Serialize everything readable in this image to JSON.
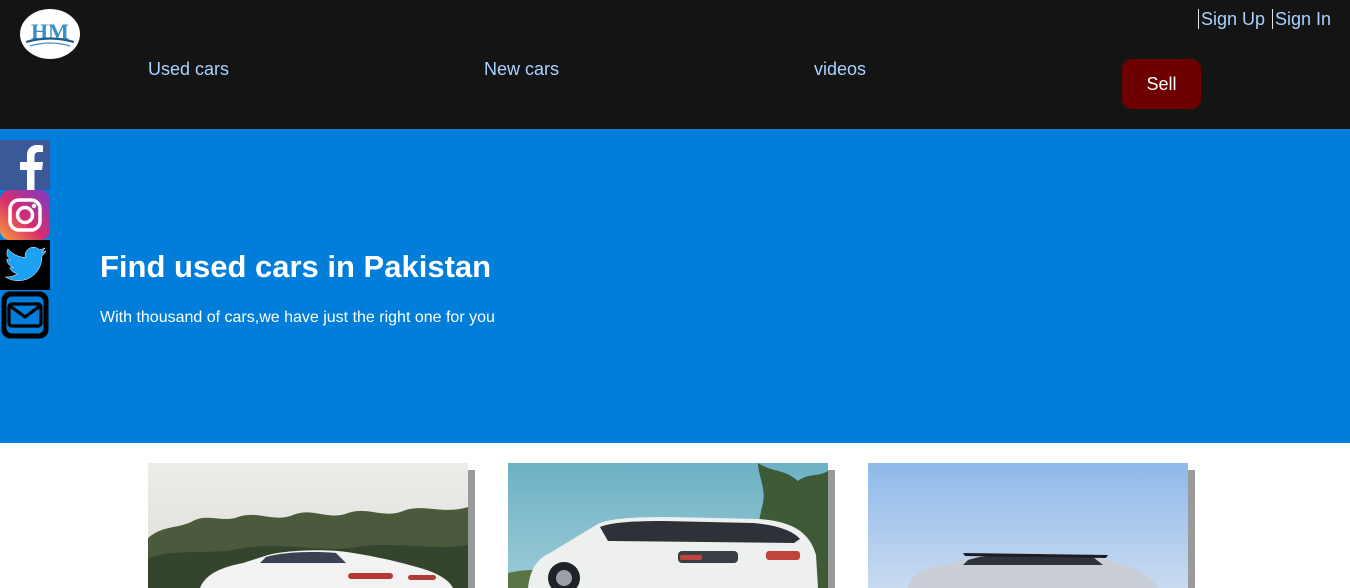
{
  "header": {
    "logo_text": "HM",
    "auth": {
      "sign_up": "Sign Up",
      "sign_in": "Sign In"
    },
    "nav": {
      "used_cars": "Used cars",
      "new_cars": "New cars",
      "videos": "videos"
    },
    "sell_label": "Sell"
  },
  "social": [
    "facebook-icon",
    "instagram-icon",
    "twitter-icon",
    "mail-icon"
  ],
  "hero": {
    "title": "Find used cars in Pakistan",
    "subtitle": "With thousand of cars,we have just the right one for you"
  },
  "colors": {
    "header_bg": "#141414",
    "hero_bg": "#007ed9",
    "nav_text": "#a9d2ff",
    "sell_bg": "#6e0000",
    "card_shadow": "#9a9a9a"
  },
  "cards": [
    "white-sedan-photo",
    "white-suv-photo",
    "silver-crossover-photo"
  ]
}
